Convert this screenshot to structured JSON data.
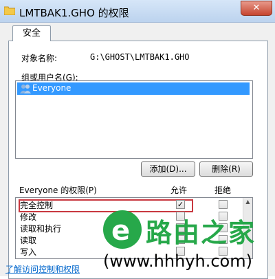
{
  "window": {
    "title": "LMTBAK1.GHO 的权限",
    "close_label": "✕"
  },
  "tabs": [
    {
      "label": "安全"
    }
  ],
  "object": {
    "label": "对象名称:",
    "value": "G:\\GHOST\\LMTBAK1.GHO"
  },
  "groups": {
    "label": "组或用户名(G):",
    "items": [
      {
        "name": "Everyone",
        "selected": true
      }
    ]
  },
  "buttons": {
    "add": "添加(D)...",
    "remove": "删除(R)"
  },
  "permissions": {
    "header": "Everyone 的权限(P)",
    "allow_label": "允许",
    "deny_label": "拒绝",
    "rows": [
      {
        "name": "完全控制",
        "allow": "✓",
        "deny": ""
      },
      {
        "name": "修改",
        "allow": "",
        "deny": ""
      },
      {
        "name": "读取和执行",
        "allow": "",
        "deny": ""
      },
      {
        "name": "读取",
        "allow": "",
        "deny": ""
      },
      {
        "name": "写入",
        "allow": "",
        "deny": ""
      }
    ]
  },
  "link": "了解访问控制和权限",
  "watermark": {
    "logo_letter": "e",
    "title": "路由之家",
    "url": "(www.hhhyh.com)"
  },
  "colors": {
    "highlight": "#c8383f",
    "selection": "#3399ff",
    "watermark_green": "#27a84a"
  }
}
